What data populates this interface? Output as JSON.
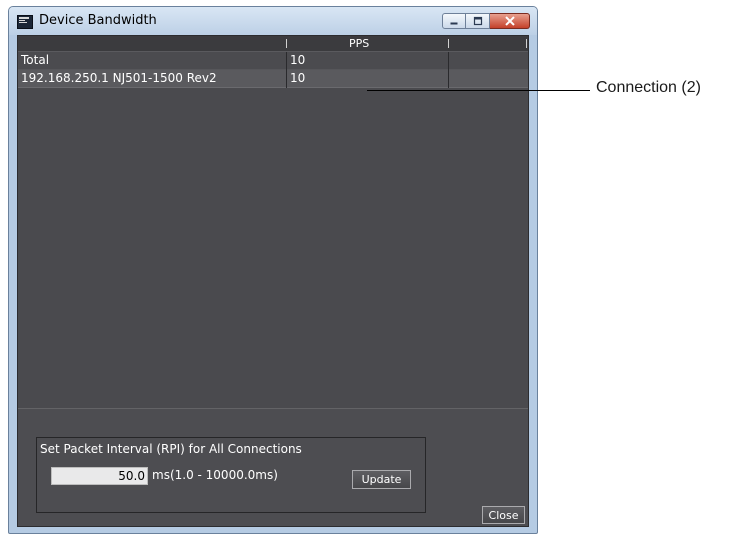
{
  "window": {
    "title": "Device Bandwidth",
    "icon": "app-window-icon",
    "controls": [
      "minimize-icon",
      "maximize-icon",
      "close-icon"
    ]
  },
  "table": {
    "columns": [
      "",
      "PPS",
      ""
    ],
    "rows": [
      {
        "name": "Total",
        "pps": "10"
      },
      {
        "name": "192.168.250.1 NJ501-1500 Rev2",
        "pps": "10"
      }
    ]
  },
  "rpi": {
    "group_title": "Set Packet Interval (RPI) for All Connections",
    "value": "50.0",
    "unit_range": "ms(1.0 - 10000.0ms)",
    "update_label": "Update"
  },
  "footer": {
    "close_label": "Close"
  },
  "annotation": {
    "label": "Connection (2)"
  },
  "colors": {
    "client_bg": "#4d4d51",
    "titlebar": "#bcd0e6",
    "close_button": "#c4412a"
  }
}
